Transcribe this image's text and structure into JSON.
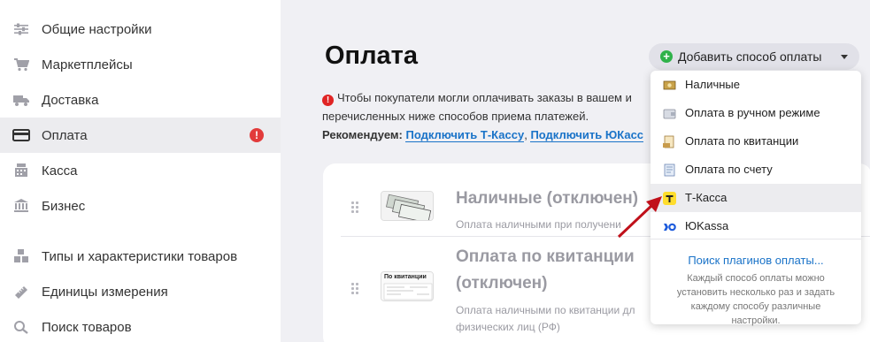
{
  "sidebar": {
    "items": [
      {
        "label": "Общие настройки",
        "icon": "sliders-icon"
      },
      {
        "label": "Маркетплейсы",
        "icon": "cart-icon"
      },
      {
        "label": "Доставка",
        "icon": "truck-icon"
      },
      {
        "label": "Оплата",
        "icon": "credit-card-icon",
        "active": true,
        "alert": "!"
      },
      {
        "label": "Касса",
        "icon": "cash-register-icon"
      },
      {
        "label": "Бизнес",
        "icon": "bank-icon"
      },
      {
        "label": "Типы и характеристики товаров",
        "icon": "cubes-icon"
      },
      {
        "label": "Единицы измерения",
        "icon": "ruler-icon"
      },
      {
        "label": "Поиск товаров",
        "icon": "search-icon"
      }
    ]
  },
  "main": {
    "title": "Оплата",
    "info_text": "Чтобы покупатели могли оплачивать заказы в вашем и",
    "info_text2": "перечисленных ниже способов приема платежей.",
    "recommend_label": "Рекомендуем:",
    "recommend_link1": "Подключить Т-Кассу",
    "recommend_sep": ",",
    "recommend_link2": "Подключить ЮКасс",
    "payments": [
      {
        "title": "Наличные (отключен)",
        "desc": "Оплата наличными при получени"
      },
      {
        "title_line1": "Оплата по квитанции",
        "title_line2": "(отключен)",
        "desc_line1": "Оплата наличными по квитанции дл",
        "desc_line2": "физических лиц (РФ)",
        "thumb_label": "По квитанции"
      }
    ]
  },
  "add_button": {
    "label": "Добавить способ оплаты"
  },
  "dropdown": {
    "items": [
      {
        "label": "Наличные",
        "icon": "cash-icon"
      },
      {
        "label": "Оплата в ручном режиме",
        "icon": "wallet-icon"
      },
      {
        "label": "Оплата по квитанции",
        "icon": "receipt-icon"
      },
      {
        "label": "Оплата по счету",
        "icon": "invoice-icon"
      },
      {
        "label": "Т-Касса",
        "icon": "t-kassa-icon",
        "highlighted": true
      },
      {
        "label": "ЮKassa",
        "icon": "yookassa-icon"
      }
    ],
    "plugin_link": "Поиск плагинов оплаты...",
    "note": "Каждый способ оплаты можно установить несколько раз и задать каждому способу различные настройки."
  },
  "colors": {
    "accent_link": "#1a73c8",
    "alert_red": "#e23b3b",
    "add_green": "#2fb24a",
    "annotation_arrow": "#c0101a"
  }
}
